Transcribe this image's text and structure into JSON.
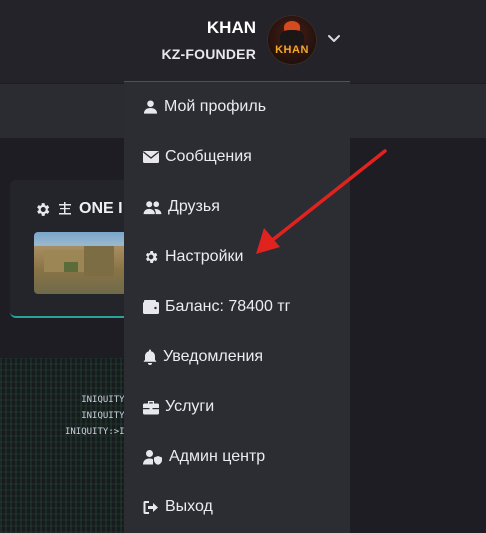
{
  "user": {
    "name": "KHAN",
    "role": "KZ-FOUNDER",
    "avatar_text": "KHAN"
  },
  "server_card": {
    "title": "ONE I"
  },
  "banner": {
    "lines": [
      "INIQUITY:",
      "INIQUITY:",
      "INIQUITY:>IN"
    ]
  },
  "menu": {
    "items": [
      {
        "label": "Мой профиль",
        "icon": "user-icon"
      },
      {
        "label": "Сообщения",
        "icon": "envelope-icon"
      },
      {
        "label": "Друзья",
        "icon": "users-icon"
      },
      {
        "label": "Настройки",
        "icon": "gear-icon"
      },
      {
        "label": "Баланс: 78400 тг",
        "icon": "wallet-icon"
      },
      {
        "label": "Уведомления",
        "icon": "bell-icon"
      },
      {
        "label": "Услуги",
        "icon": "briefcase-icon"
      },
      {
        "label": "Админ центр",
        "icon": "user-shield-icon"
      },
      {
        "label": "Выход",
        "icon": "sign-out-icon"
      }
    ]
  },
  "colors": {
    "menu_bg": "#2c2c33",
    "arrow": "#e0231f",
    "accent": "#2aa39a"
  }
}
